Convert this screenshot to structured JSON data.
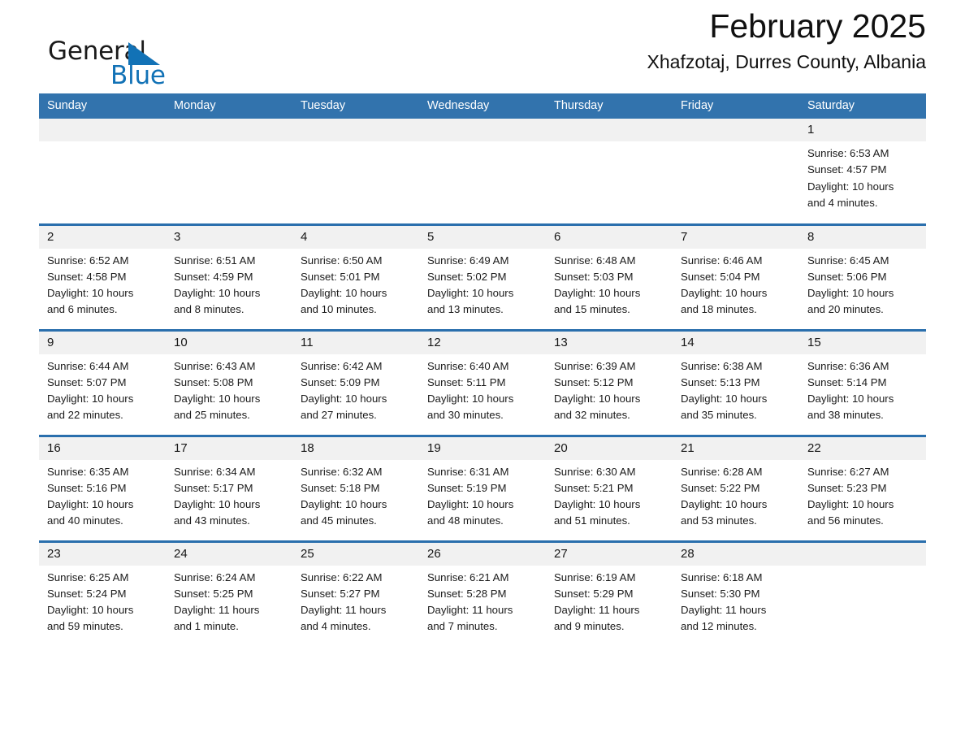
{
  "brand": {
    "name_part1": "General",
    "name_part2": "Blue",
    "accent_color": "#1272b6"
  },
  "header": {
    "month_title": "February 2025",
    "location": "Xhafzotaj, Durres County, Albania"
  },
  "calendar": {
    "header_bg": "#3273ad",
    "separator_color": "#2a6fad",
    "daynum_bg": "#f1f1f1",
    "weekday_headers": [
      "Sunday",
      "Monday",
      "Tuesday",
      "Wednesday",
      "Thursday",
      "Friday",
      "Saturday"
    ],
    "weeks": [
      [
        {
          "day": "",
          "sunrise": "",
          "sunset": "",
          "daylight1": "",
          "daylight2": ""
        },
        {
          "day": "",
          "sunrise": "",
          "sunset": "",
          "daylight1": "",
          "daylight2": ""
        },
        {
          "day": "",
          "sunrise": "",
          "sunset": "",
          "daylight1": "",
          "daylight2": ""
        },
        {
          "day": "",
          "sunrise": "",
          "sunset": "",
          "daylight1": "",
          "daylight2": ""
        },
        {
          "day": "",
          "sunrise": "",
          "sunset": "",
          "daylight1": "",
          "daylight2": ""
        },
        {
          "day": "",
          "sunrise": "",
          "sunset": "",
          "daylight1": "",
          "daylight2": ""
        },
        {
          "day": "1",
          "sunrise": "Sunrise: 6:53 AM",
          "sunset": "Sunset: 4:57 PM",
          "daylight1": "Daylight: 10 hours",
          "daylight2": "and 4 minutes."
        }
      ],
      [
        {
          "day": "2",
          "sunrise": "Sunrise: 6:52 AM",
          "sunset": "Sunset: 4:58 PM",
          "daylight1": "Daylight: 10 hours",
          "daylight2": "and 6 minutes."
        },
        {
          "day": "3",
          "sunrise": "Sunrise: 6:51 AM",
          "sunset": "Sunset: 4:59 PM",
          "daylight1": "Daylight: 10 hours",
          "daylight2": "and 8 minutes."
        },
        {
          "day": "4",
          "sunrise": "Sunrise: 6:50 AM",
          "sunset": "Sunset: 5:01 PM",
          "daylight1": "Daylight: 10 hours",
          "daylight2": "and 10 minutes."
        },
        {
          "day": "5",
          "sunrise": "Sunrise: 6:49 AM",
          "sunset": "Sunset: 5:02 PM",
          "daylight1": "Daylight: 10 hours",
          "daylight2": "and 13 minutes."
        },
        {
          "day": "6",
          "sunrise": "Sunrise: 6:48 AM",
          "sunset": "Sunset: 5:03 PM",
          "daylight1": "Daylight: 10 hours",
          "daylight2": "and 15 minutes."
        },
        {
          "day": "7",
          "sunrise": "Sunrise: 6:46 AM",
          "sunset": "Sunset: 5:04 PM",
          "daylight1": "Daylight: 10 hours",
          "daylight2": "and 18 minutes."
        },
        {
          "day": "8",
          "sunrise": "Sunrise: 6:45 AM",
          "sunset": "Sunset: 5:06 PM",
          "daylight1": "Daylight: 10 hours",
          "daylight2": "and 20 minutes."
        }
      ],
      [
        {
          "day": "9",
          "sunrise": "Sunrise: 6:44 AM",
          "sunset": "Sunset: 5:07 PM",
          "daylight1": "Daylight: 10 hours",
          "daylight2": "and 22 minutes."
        },
        {
          "day": "10",
          "sunrise": "Sunrise: 6:43 AM",
          "sunset": "Sunset: 5:08 PM",
          "daylight1": "Daylight: 10 hours",
          "daylight2": "and 25 minutes."
        },
        {
          "day": "11",
          "sunrise": "Sunrise: 6:42 AM",
          "sunset": "Sunset: 5:09 PM",
          "daylight1": "Daylight: 10 hours",
          "daylight2": "and 27 minutes."
        },
        {
          "day": "12",
          "sunrise": "Sunrise: 6:40 AM",
          "sunset": "Sunset: 5:11 PM",
          "daylight1": "Daylight: 10 hours",
          "daylight2": "and 30 minutes."
        },
        {
          "day": "13",
          "sunrise": "Sunrise: 6:39 AM",
          "sunset": "Sunset: 5:12 PM",
          "daylight1": "Daylight: 10 hours",
          "daylight2": "and 32 minutes."
        },
        {
          "day": "14",
          "sunrise": "Sunrise: 6:38 AM",
          "sunset": "Sunset: 5:13 PM",
          "daylight1": "Daylight: 10 hours",
          "daylight2": "and 35 minutes."
        },
        {
          "day": "15",
          "sunrise": "Sunrise: 6:36 AM",
          "sunset": "Sunset: 5:14 PM",
          "daylight1": "Daylight: 10 hours",
          "daylight2": "and 38 minutes."
        }
      ],
      [
        {
          "day": "16",
          "sunrise": "Sunrise: 6:35 AM",
          "sunset": "Sunset: 5:16 PM",
          "daylight1": "Daylight: 10 hours",
          "daylight2": "and 40 minutes."
        },
        {
          "day": "17",
          "sunrise": "Sunrise: 6:34 AM",
          "sunset": "Sunset: 5:17 PM",
          "daylight1": "Daylight: 10 hours",
          "daylight2": "and 43 minutes."
        },
        {
          "day": "18",
          "sunrise": "Sunrise: 6:32 AM",
          "sunset": "Sunset: 5:18 PM",
          "daylight1": "Daylight: 10 hours",
          "daylight2": "and 45 minutes."
        },
        {
          "day": "19",
          "sunrise": "Sunrise: 6:31 AM",
          "sunset": "Sunset: 5:19 PM",
          "daylight1": "Daylight: 10 hours",
          "daylight2": "and 48 minutes."
        },
        {
          "day": "20",
          "sunrise": "Sunrise: 6:30 AM",
          "sunset": "Sunset: 5:21 PM",
          "daylight1": "Daylight: 10 hours",
          "daylight2": "and 51 minutes."
        },
        {
          "day": "21",
          "sunrise": "Sunrise: 6:28 AM",
          "sunset": "Sunset: 5:22 PM",
          "daylight1": "Daylight: 10 hours",
          "daylight2": "and 53 minutes."
        },
        {
          "day": "22",
          "sunrise": "Sunrise: 6:27 AM",
          "sunset": "Sunset: 5:23 PM",
          "daylight1": "Daylight: 10 hours",
          "daylight2": "and 56 minutes."
        }
      ],
      [
        {
          "day": "23",
          "sunrise": "Sunrise: 6:25 AM",
          "sunset": "Sunset: 5:24 PM",
          "daylight1": "Daylight: 10 hours",
          "daylight2": "and 59 minutes."
        },
        {
          "day": "24",
          "sunrise": "Sunrise: 6:24 AM",
          "sunset": "Sunset: 5:25 PM",
          "daylight1": "Daylight: 11 hours",
          "daylight2": "and 1 minute."
        },
        {
          "day": "25",
          "sunrise": "Sunrise: 6:22 AM",
          "sunset": "Sunset: 5:27 PM",
          "daylight1": "Daylight: 11 hours",
          "daylight2": "and 4 minutes."
        },
        {
          "day": "26",
          "sunrise": "Sunrise: 6:21 AM",
          "sunset": "Sunset: 5:28 PM",
          "daylight1": "Daylight: 11 hours",
          "daylight2": "and 7 minutes."
        },
        {
          "day": "27",
          "sunrise": "Sunrise: 6:19 AM",
          "sunset": "Sunset: 5:29 PM",
          "daylight1": "Daylight: 11 hours",
          "daylight2": "and 9 minutes."
        },
        {
          "day": "28",
          "sunrise": "Sunrise: 6:18 AM",
          "sunset": "Sunset: 5:30 PM",
          "daylight1": "Daylight: 11 hours",
          "daylight2": "and 12 minutes."
        },
        {
          "day": "",
          "sunrise": "",
          "sunset": "",
          "daylight1": "",
          "daylight2": ""
        }
      ]
    ]
  }
}
